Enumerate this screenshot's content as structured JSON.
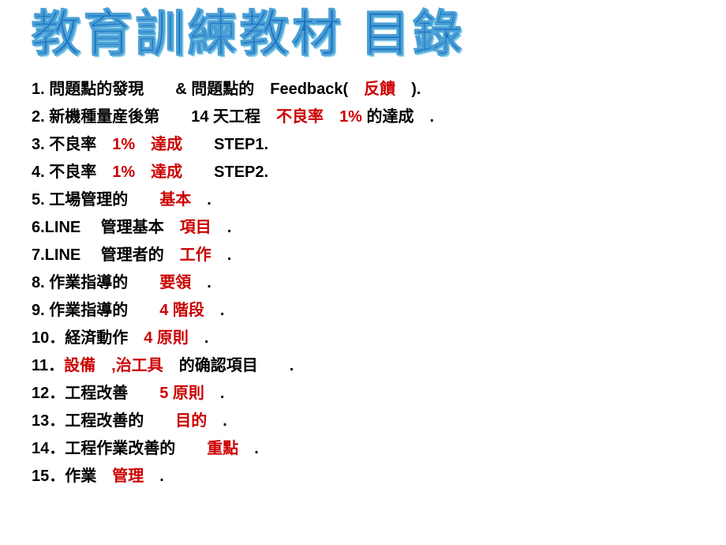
{
  "title": "教育訓練教材  目錄",
  "items": [
    {
      "id": 1,
      "parts": [
        {
          "text": "1. 問題點的發現　　",
          "color": "black"
        },
        {
          "text": "& 問題點的　",
          "color": "black"
        },
        {
          "text": "Feedback(",
          "color": "black"
        },
        {
          "text": "　反饋　",
          "color": "red"
        },
        {
          "text": ").",
          "color": "black"
        }
      ]
    },
    {
      "id": 2,
      "parts": [
        {
          "text": "2. 新機種量産後第　　",
          "color": "black"
        },
        {
          "text": "14",
          "color": "black"
        },
        {
          "text": " 天工程　",
          "color": "black"
        },
        {
          "text": "不良率　",
          "color": "red"
        },
        {
          "text": "1%",
          "color": "red"
        },
        {
          "text": " 的達成　.",
          "color": "black"
        }
      ]
    },
    {
      "id": 3,
      "parts": [
        {
          "text": "3. 不良率　",
          "color": "black"
        },
        {
          "text": "1%",
          "color": "red"
        },
        {
          "text": "　達成",
          "color": "red"
        },
        {
          "text": "　　STEP1.",
          "color": "black"
        }
      ]
    },
    {
      "id": 4,
      "parts": [
        {
          "text": "4. 不良率　",
          "color": "black"
        },
        {
          "text": "1%",
          "color": "red"
        },
        {
          "text": "　達成",
          "color": "red"
        },
        {
          "text": "　　STEP2.",
          "color": "black"
        }
      ]
    },
    {
      "id": 5,
      "parts": [
        {
          "text": "5. 工場管理的　　",
          "color": "black"
        },
        {
          "text": "基本",
          "color": "red"
        },
        {
          "text": "　.",
          "color": "black"
        }
      ]
    },
    {
      "id": 6,
      "parts": [
        {
          "text": "6.LINE　 管理基本　",
          "color": "black"
        },
        {
          "text": "項目",
          "color": "red"
        },
        {
          "text": "　.",
          "color": "black"
        }
      ]
    },
    {
      "id": 7,
      "parts": [
        {
          "text": "7.LINE　 管理者的　",
          "color": "black"
        },
        {
          "text": "工作",
          "color": "red"
        },
        {
          "text": "　.",
          "color": "black"
        }
      ]
    },
    {
      "id": 8,
      "parts": [
        {
          "text": "8. 作業指導的　　",
          "color": "black"
        },
        {
          "text": "要領",
          "color": "red"
        },
        {
          "text": "　.",
          "color": "black"
        }
      ]
    },
    {
      "id": 9,
      "parts": [
        {
          "text": "9. 作業指導的　　",
          "color": "black"
        },
        {
          "text": "4 階段",
          "color": "red"
        },
        {
          "text": "　.",
          "color": "black"
        }
      ]
    },
    {
      "id": 10,
      "parts": [
        {
          "text": "10．経済動作　",
          "color": "black"
        },
        {
          "text": "4 原則",
          "color": "red"
        },
        {
          "text": "　.",
          "color": "black"
        }
      ]
    },
    {
      "id": 11,
      "parts": [
        {
          "text": "11．",
          "color": "black"
        },
        {
          "text": "設備　,治工具",
          "color": "red"
        },
        {
          "text": "　的确認項目　　.",
          "color": "black"
        }
      ]
    },
    {
      "id": 12,
      "parts": [
        {
          "text": "12．工程改善　　",
          "color": "black"
        },
        {
          "text": "5 原則",
          "color": "red"
        },
        {
          "text": "　.",
          "color": "black"
        }
      ]
    },
    {
      "id": 13,
      "parts": [
        {
          "text": "13．工程改善的　　",
          "color": "black"
        },
        {
          "text": "目的",
          "color": "red"
        },
        {
          "text": "　.",
          "color": "black"
        }
      ]
    },
    {
      "id": 14,
      "parts": [
        {
          "text": "14．工程作業改善的　　",
          "color": "black"
        },
        {
          "text": "重點",
          "color": "red"
        },
        {
          "text": "　.",
          "color": "black"
        }
      ]
    },
    {
      "id": 15,
      "parts": [
        {
          "text": "15．作業　",
          "color": "black"
        },
        {
          "text": "管理",
          "color": "red"
        },
        {
          "text": "　.",
          "color": "black"
        }
      ]
    }
  ]
}
